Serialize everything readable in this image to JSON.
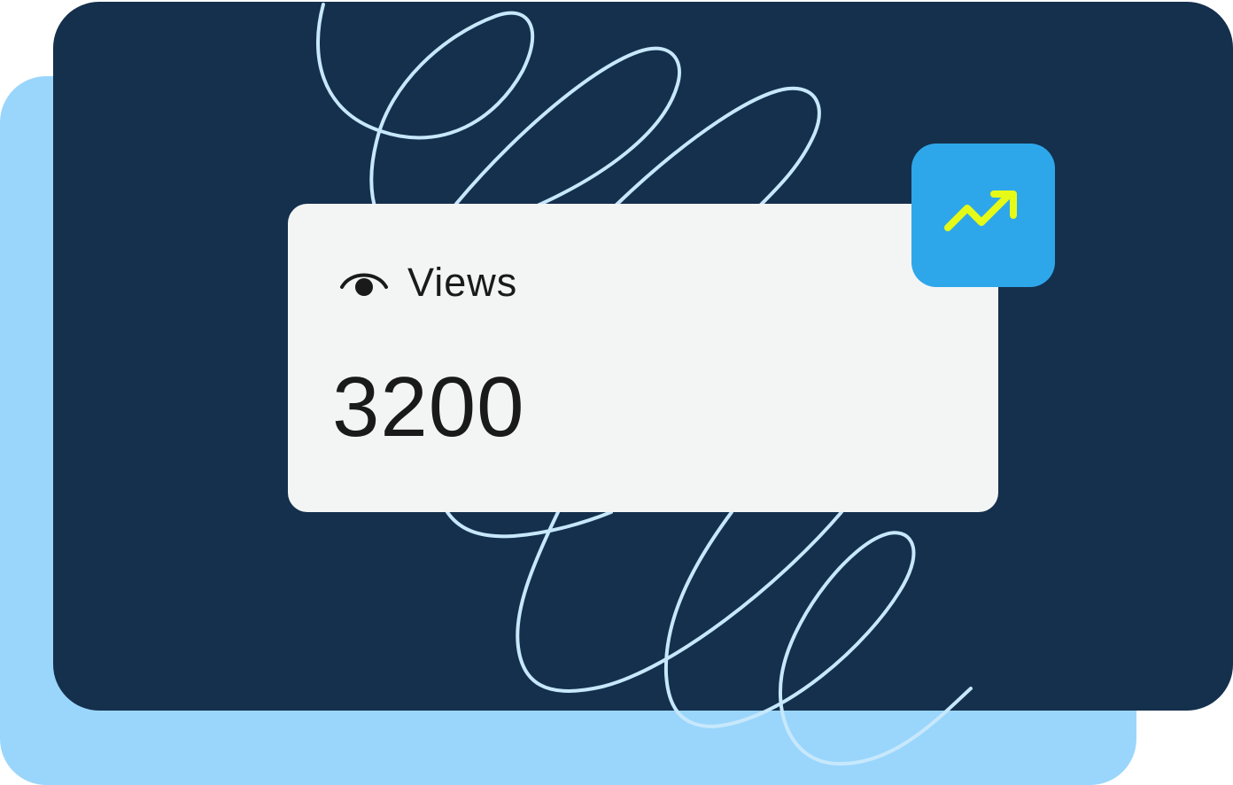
{
  "colors": {
    "background": "#ffffff",
    "back_panel": "#9ad6fb",
    "front_panel": "#14304d",
    "scribble": "#c7e8fc",
    "card": "#f3f5f5",
    "badge": "#2ea7ea",
    "trend_arrow": "#e6fa17",
    "text": "#1a1a1a"
  },
  "card": {
    "icon": "eye-icon",
    "label": "Views",
    "value": "3200"
  },
  "badge": {
    "icon": "trending-up-icon"
  }
}
